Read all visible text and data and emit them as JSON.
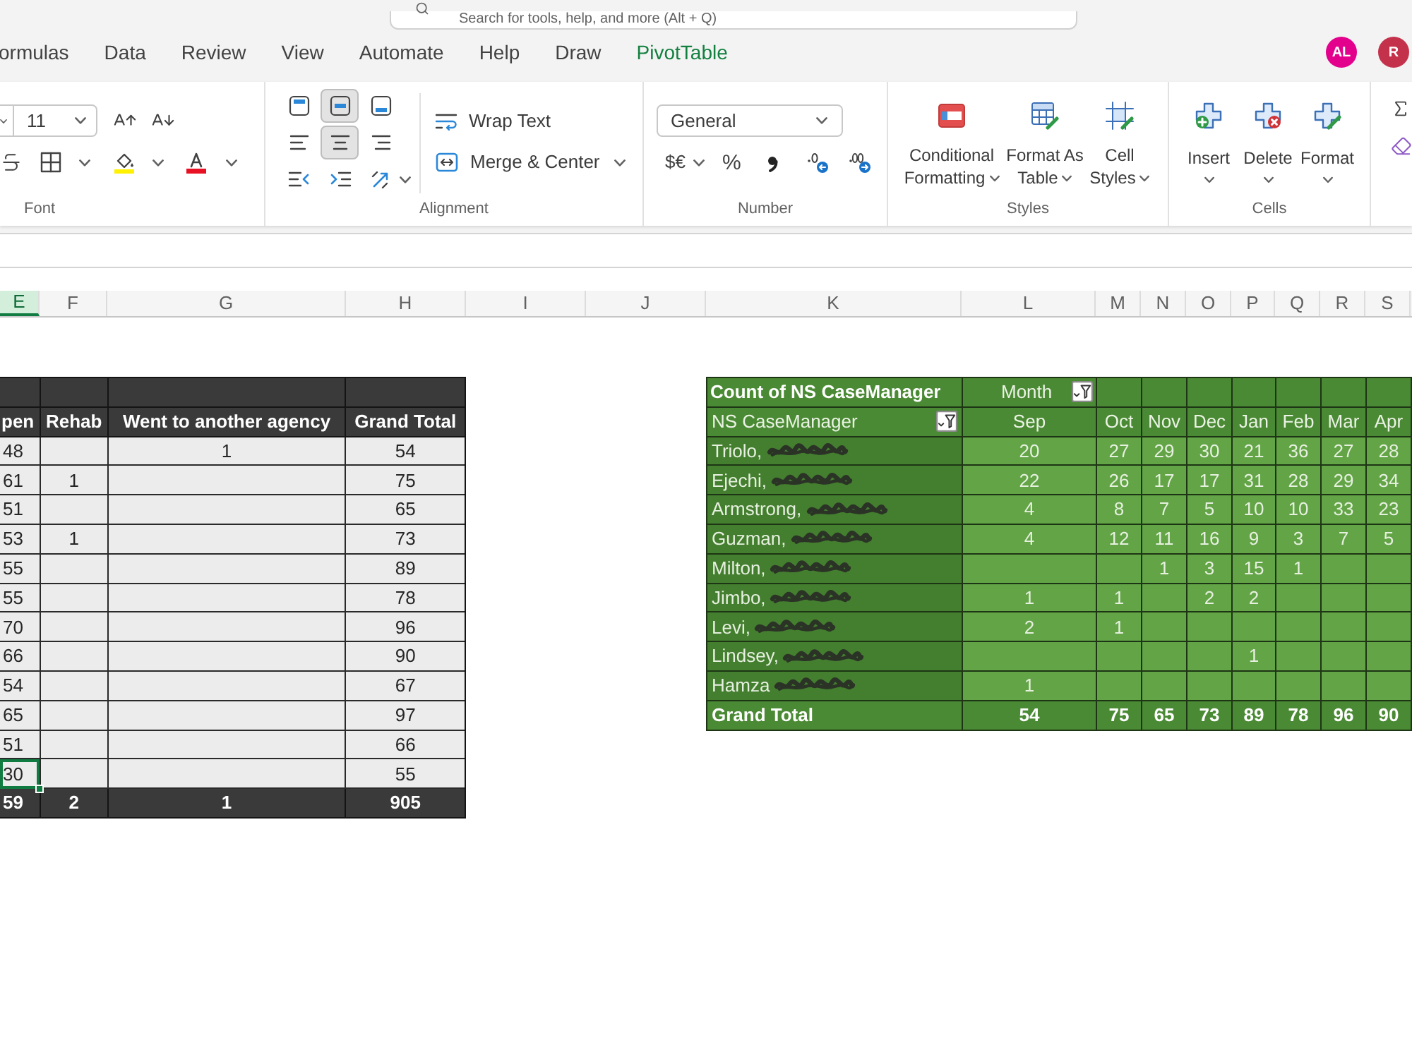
{
  "search": {
    "placeholder": "Search for tools, help, and more (Alt + Q)"
  },
  "tabs": [
    {
      "label": "ormulas",
      "kind": "normal"
    },
    {
      "label": "Data",
      "kind": "normal"
    },
    {
      "label": "Review",
      "kind": "normal"
    },
    {
      "label": "View",
      "kind": "normal"
    },
    {
      "label": "Automate",
      "kind": "normal"
    },
    {
      "label": "Help",
      "kind": "normal"
    },
    {
      "label": "Draw",
      "kind": "normal"
    },
    {
      "label": "PivotTable",
      "kind": "contextual"
    }
  ],
  "avatars": [
    {
      "initials": "AL",
      "color": "#e3008c"
    },
    {
      "initials": "R",
      "color": "#c4314b"
    }
  ],
  "ribbon": {
    "font": {
      "label": "Font",
      "size": "11"
    },
    "alignment": {
      "label": "Alignment",
      "vertical": [
        {
          "kind": "top",
          "selected": false
        },
        {
          "kind": "middle",
          "selected": true
        },
        {
          "kind": "bottom",
          "selected": false
        }
      ],
      "horizontal": [
        {
          "kind": "left",
          "selected": false
        },
        {
          "kind": "center",
          "selected": true
        },
        {
          "kind": "right",
          "selected": false
        }
      ],
      "wrap_text": "Wrap Text",
      "merge": "Merge & Center"
    },
    "number": {
      "label": "Number",
      "format": "General",
      "accounting": "$€",
      "percent": "%"
    },
    "styles": {
      "label": "Styles",
      "buttons": [
        {
          "kind": "conditional",
          "label": "Conditional Formatting"
        },
        {
          "kind": "table",
          "label": "Format As Table"
        },
        {
          "kind": "cell_styles",
          "label": "Cell Styles"
        }
      ]
    },
    "cells": {
      "label": "Cells",
      "buttons": [
        {
          "kind": "insert",
          "label": "Insert"
        },
        {
          "kind": "delete",
          "label": "Delete"
        },
        {
          "kind": "format",
          "label": "Format"
        }
      ]
    }
  },
  "column_headers": [
    {
      "label": "E",
      "selected": true
    },
    {
      "label": "F",
      "selected": false
    },
    {
      "label": "G",
      "selected": false
    },
    {
      "label": "H",
      "selected": false
    },
    {
      "label": "I",
      "selected": false
    },
    {
      "label": "J",
      "selected": false
    },
    {
      "label": "K",
      "selected": false
    },
    {
      "label": "L",
      "selected": false
    },
    {
      "label": "M",
      "selected": false
    },
    {
      "label": "N",
      "selected": false
    },
    {
      "label": "O",
      "selected": false
    },
    {
      "label": "P",
      "selected": false
    },
    {
      "label": "Q",
      "selected": false
    },
    {
      "label": "R",
      "selected": false
    },
    {
      "label": "S",
      "selected": false
    }
  ],
  "left_table": {
    "columns": [
      "pen",
      "Rehab",
      "Went to another agency",
      "Grand Total"
    ],
    "rows": [
      [
        {
          "text": "48",
          "selected": false
        },
        {
          "selected": false
        },
        {
          "text": "1",
          "selected": false
        },
        {
          "text": "54",
          "selected": false
        }
      ],
      [
        {
          "text": "61",
          "selected": false
        },
        {
          "text": "1",
          "selected": false
        },
        {
          "selected": false
        },
        {
          "text": "75",
          "selected": false
        }
      ],
      [
        {
          "text": "51",
          "selected": false
        },
        {
          "selected": false
        },
        {
          "selected": false
        },
        {
          "text": "65",
          "selected": false
        }
      ],
      [
        {
          "text": "53",
          "selected": false
        },
        {
          "text": "1",
          "selected": false
        },
        {
          "selected": false
        },
        {
          "text": "73",
          "selected": false
        }
      ],
      [
        {
          "text": "55",
          "selected": false
        },
        {
          "selected": false
        },
        {
          "selected": false
        },
        {
          "text": "89",
          "selected": false
        }
      ],
      [
        {
          "text": "55",
          "selected": false
        },
        {
          "selected": false
        },
        {
          "selected": false
        },
        {
          "text": "78",
          "selected": false
        }
      ],
      [
        {
          "text": "70",
          "selected": false
        },
        {
          "selected": false
        },
        {
          "selected": false
        },
        {
          "text": "96",
          "selected": false
        }
      ],
      [
        {
          "text": "66",
          "selected": false
        },
        {
          "selected": false
        },
        {
          "selected": false
        },
        {
          "text": "90",
          "selected": false
        }
      ],
      [
        {
          "text": "54",
          "selected": false
        },
        {
          "selected": false
        },
        {
          "selected": false
        },
        {
          "text": "67",
          "selected": false
        }
      ],
      [
        {
          "text": "65",
          "selected": false
        },
        {
          "selected": false
        },
        {
          "selected": false
        },
        {
          "text": "97",
          "selected": false
        }
      ],
      [
        {
          "text": "51",
          "selected": false
        },
        {
          "selected": false
        },
        {
          "selected": false
        },
        {
          "text": "66",
          "selected": false
        }
      ],
      [
        {
          "text": "30",
          "selected": true
        },
        {
          "selected": false
        },
        {
          "selected": false
        },
        {
          "text": "55",
          "selected": false
        }
      ]
    ],
    "total": [
      {
        "text": "59",
        "selected": false
      },
      {
        "text": "2",
        "selected": false
      },
      {
        "text": "1",
        "selected": false
      },
      {
        "text": "905",
        "selected": false
      }
    ]
  },
  "pivot": {
    "title": "Count of NS CaseManager",
    "column_field": {
      "label": "Month",
      "filtered": true
    },
    "row_field": {
      "label": "NS CaseManager",
      "filtered": true
    },
    "months": [
      "Sep",
      "Oct",
      "Nov",
      "Dec",
      "Jan",
      "Feb",
      "Mar",
      "Apr"
    ],
    "rows": [
      {
        "name": "Triolo,",
        "redacted": true,
        "cells": [
          {
            "kind": "number",
            "text": "20"
          },
          {
            "kind": "number",
            "text": "27"
          },
          {
            "kind": "number",
            "text": "29"
          },
          {
            "kind": "number",
            "text": "30"
          },
          {
            "kind": "number",
            "text": "21"
          },
          {
            "kind": "number",
            "text": "36"
          },
          {
            "kind": "number",
            "text": "27"
          },
          {
            "kind": "number",
            "text": "28"
          }
        ]
      },
      {
        "name": "Ejechi,",
        "redacted": true,
        "cells": [
          {
            "kind": "number",
            "text": "22"
          },
          {
            "kind": "number",
            "text": "26"
          },
          {
            "kind": "number",
            "text": "17"
          },
          {
            "kind": "number",
            "text": "17"
          },
          {
            "kind": "number",
            "text": "31"
          },
          {
            "kind": "number",
            "text": "28"
          },
          {
            "kind": "number",
            "text": "29"
          },
          {
            "kind": "number",
            "text": "34"
          }
        ]
      },
      {
        "name": "Armstrong,",
        "redacted": true,
        "cells": [
          {
            "kind": "number",
            "text": "4"
          },
          {
            "kind": "number",
            "text": "8"
          },
          {
            "kind": "number",
            "text": "7"
          },
          {
            "kind": "number",
            "text": "5"
          },
          {
            "kind": "number",
            "text": "10"
          },
          {
            "kind": "number",
            "text": "10"
          },
          {
            "kind": "number",
            "text": "33"
          },
          {
            "kind": "number",
            "text": "23"
          }
        ]
      },
      {
        "name": "Guzman,",
        "redacted": true,
        "cells": [
          {
            "kind": "number",
            "text": "4"
          },
          {
            "kind": "number",
            "text": "12"
          },
          {
            "kind": "number",
            "text": "11"
          },
          {
            "kind": "number",
            "text": "16"
          },
          {
            "kind": "number",
            "text": "9"
          },
          {
            "kind": "number",
            "text": "3"
          },
          {
            "kind": "number",
            "text": "7"
          },
          {
            "kind": "number",
            "text": "5"
          }
        ]
      },
      {
        "name": "Milton,",
        "redacted": true,
        "cells": [
          {
            "kind": "blank"
          },
          {
            "kind": "blank"
          },
          {
            "kind": "number",
            "text": "1"
          },
          {
            "kind": "number",
            "text": "3"
          },
          {
            "kind": "number",
            "text": "15"
          },
          {
            "kind": "number",
            "text": "1"
          },
          {
            "kind": "blank"
          },
          {
            "kind": "blank"
          }
        ]
      },
      {
        "name": "Jimbo,",
        "redacted": true,
        "cells": [
          {
            "kind": "number",
            "text": "1"
          },
          {
            "kind": "number",
            "text": "1"
          },
          {
            "kind": "blank"
          },
          {
            "kind": "number",
            "text": "2"
          },
          {
            "kind": "number",
            "text": "2"
          },
          {
            "kind": "blank"
          },
          {
            "kind": "blank"
          },
          {
            "kind": "blank"
          }
        ]
      },
      {
        "name": "Levi,",
        "redacted": true,
        "cells": [
          {
            "kind": "number",
            "text": "2"
          },
          {
            "kind": "number",
            "text": "1"
          },
          {
            "kind": "blank"
          },
          {
            "kind": "blank"
          },
          {
            "kind": "blank"
          },
          {
            "kind": "blank"
          },
          {
            "kind": "blank"
          },
          {
            "kind": "blank"
          }
        ]
      },
      {
        "name": "Lindsey,",
        "redacted": true,
        "cells": [
          {
            "kind": "blank"
          },
          {
            "kind": "blank"
          },
          {
            "kind": "blank"
          },
          {
            "kind": "blank"
          },
          {
            "kind": "number",
            "text": "1"
          },
          {
            "kind": "blank"
          },
          {
            "kind": "blank"
          },
          {
            "kind": "blank"
          }
        ]
      },
      {
        "name": "Hamza",
        "redacted": true,
        "cells": [
          {
            "kind": "number",
            "text": "1"
          },
          {
            "kind": "blank"
          },
          {
            "kind": "blank"
          },
          {
            "kind": "blank"
          },
          {
            "kind": "blank"
          },
          {
            "kind": "blank"
          },
          {
            "kind": "blank"
          },
          {
            "kind": "blank"
          }
        ]
      }
    ],
    "total": {
      "label": "Grand Total",
      "values": [
        "54",
        "75",
        "65",
        "73",
        "89",
        "78",
        "96",
        "90"
      ]
    }
  }
}
